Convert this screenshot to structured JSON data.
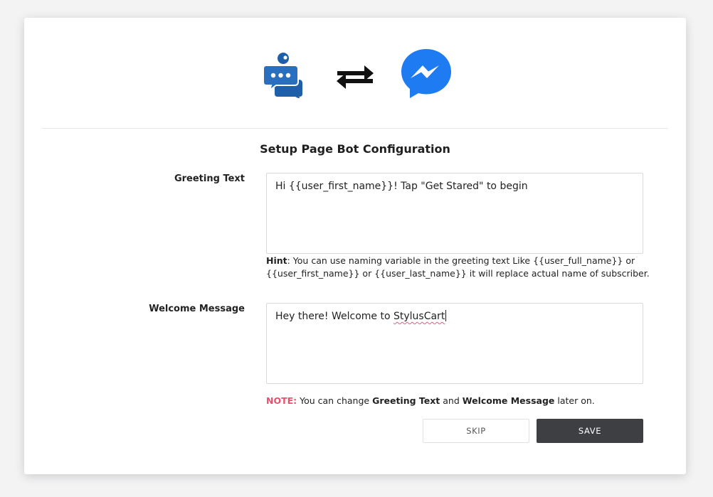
{
  "header": {
    "icons": [
      "chat-bot-icon",
      "swap-arrows-icon",
      "messenger-icon"
    ],
    "brand_color_bot": "#1f5fa8",
    "brand_color_messenger": "#1e7bf2"
  },
  "title": "Setup Page Bot Configuration",
  "greeting": {
    "label": "Greeting Text",
    "value": "Hi {{user_first_name}}! Tap \"Get Stared\" to begin",
    "hint_label": "Hint",
    "hint_text": ": You can use naming variable in the greeting text Like {{user_full_name}} or {{user_first_name}} or {{user_last_name}} it will replace actual name of subscriber."
  },
  "welcome": {
    "label": "Welcome Message",
    "value_prefix": "Hey there! Welcome to ",
    "value_misspelled": "StylusCart"
  },
  "note": {
    "tag": "NOTE:",
    "part1": " You can change ",
    "strong1": "Greeting Text",
    "part2": " and ",
    "strong2": "Welcome Message",
    "part3": " later on."
  },
  "buttons": {
    "skip_label": "SKIP",
    "save_label": "SAVE"
  },
  "colors": {
    "note_accent": "#e8506d",
    "save_button_bg": "#3d3f43"
  }
}
